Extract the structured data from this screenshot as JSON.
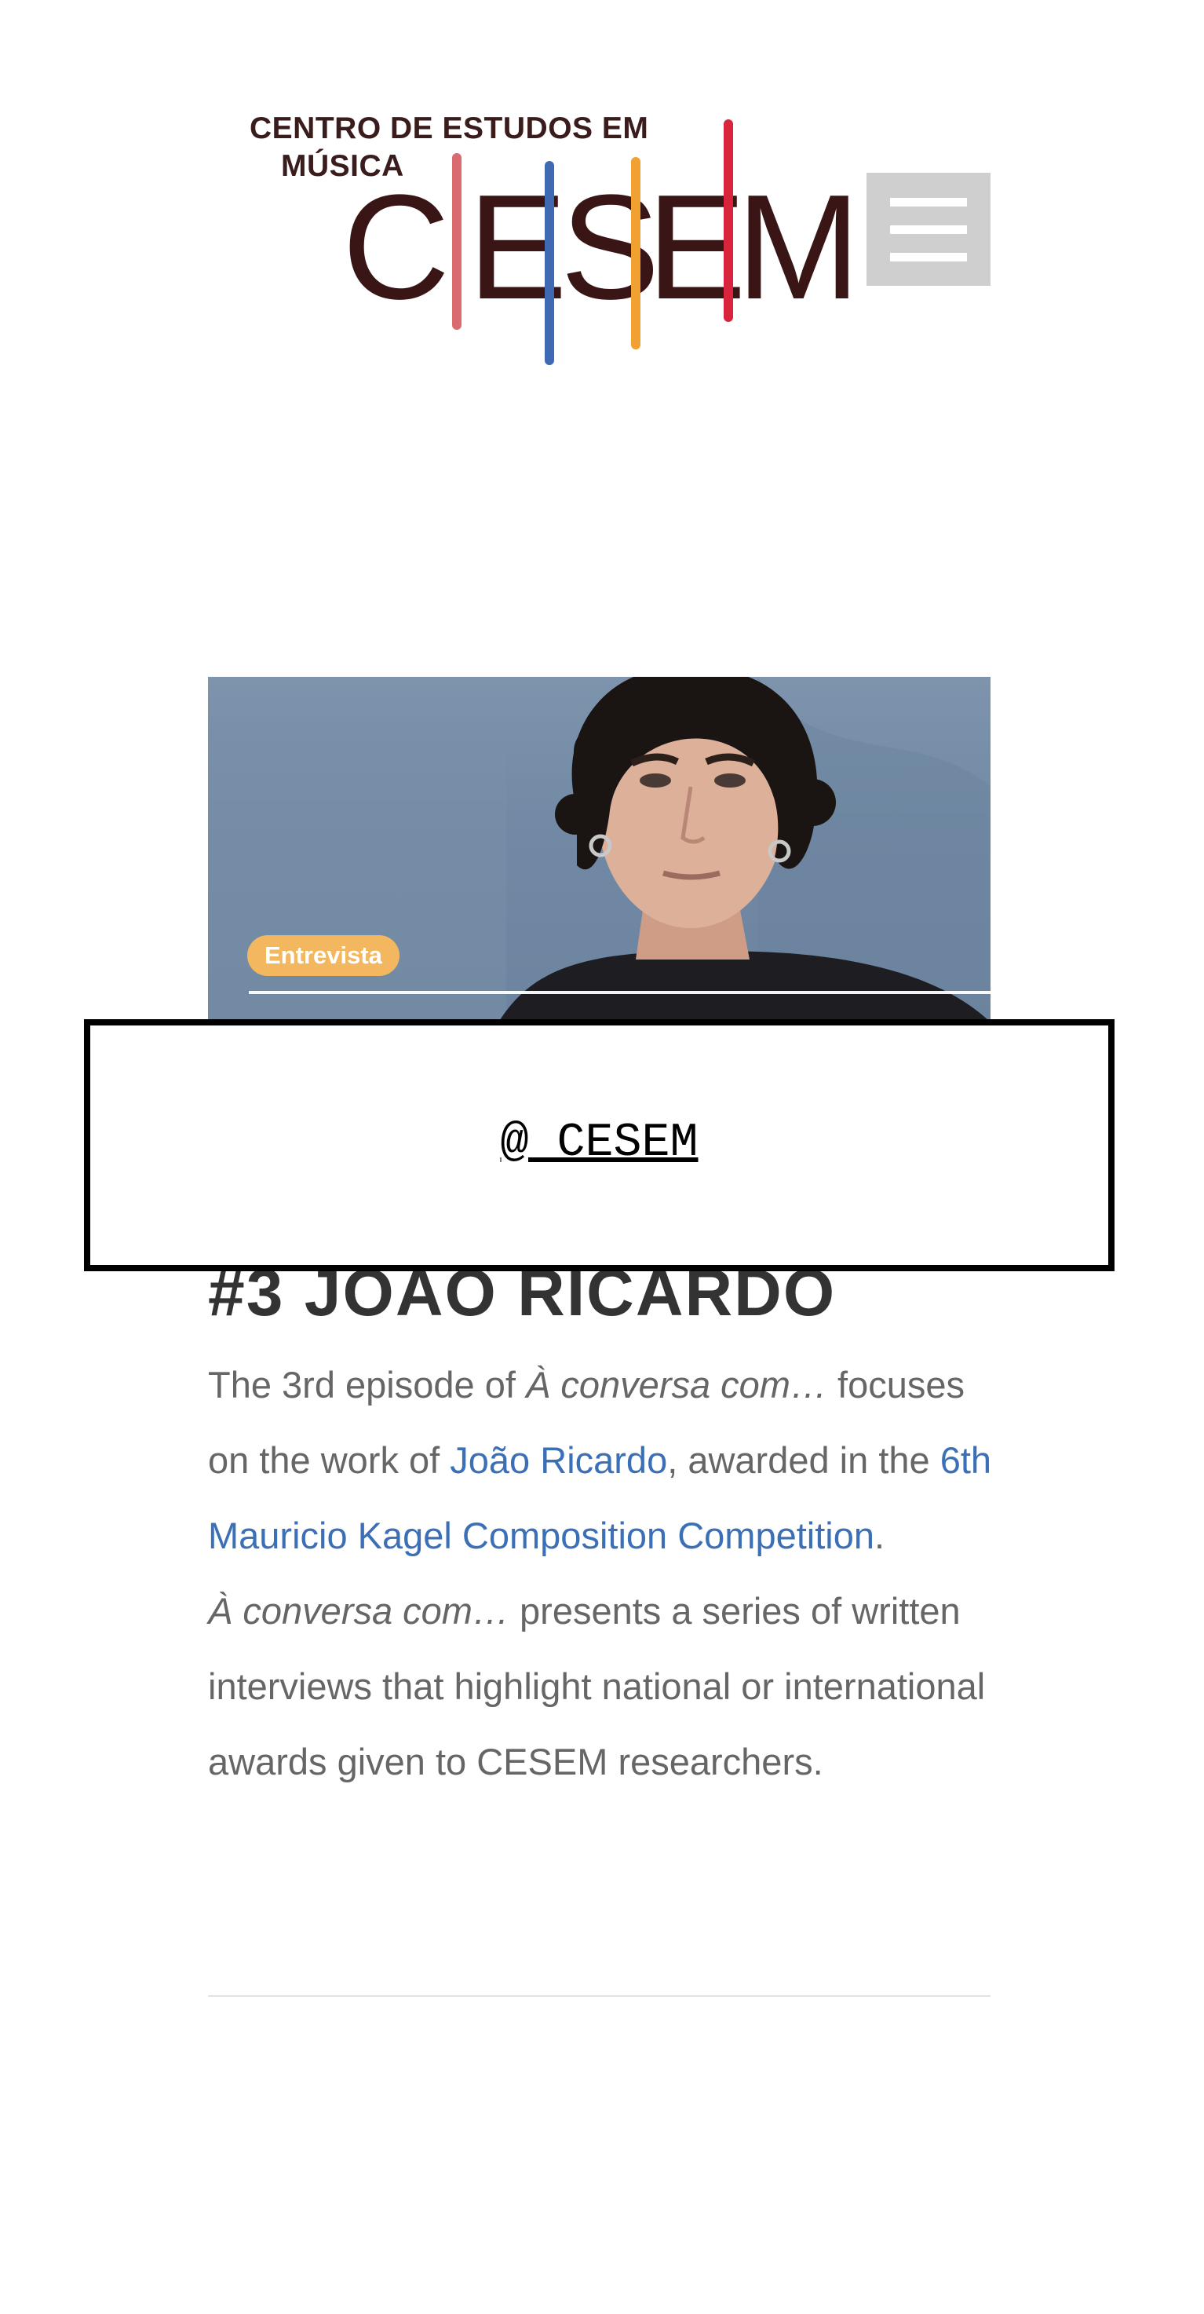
{
  "header": {
    "logo": {
      "top_text_line1": "CENTRO DE ESTUDOS EM",
      "top_text_line2": "MÚSICA",
      "letters": [
        "C",
        "E",
        "S",
        "E",
        "M"
      ],
      "bar_colors": [
        "#d96a6f",
        "#3f69b3",
        "#f0a132",
        "#d8243d"
      ]
    },
    "menu_icon": "hamburger-menu-icon"
  },
  "article": {
    "image_badge": "Entrevista",
    "title": "#3 JOÃO RICARDO",
    "body": {
      "p1_t1": "The 3rd episode of ",
      "p1_em": "À conversa com…",
      "p1_t2": " focuses on the work of ",
      "p1_link1": "João Ricardo",
      "p1_t3": ", awarded in the ",
      "p1_link2": "6th Mauricio Kagel Composition Competition",
      "p1_t4": ".",
      "p2_em": "À conversa com…",
      "p2_t1": " presents a series of written interviews that highlight national or international awards given to CESEM researchers."
    }
  },
  "overlay": {
    "link_text": "@ CESEM"
  },
  "colors": {
    "link": "#3b6fb6",
    "body_text": "#666666",
    "badge_bg": "#f3b75f",
    "menu_bg": "#cfcfcf"
  }
}
